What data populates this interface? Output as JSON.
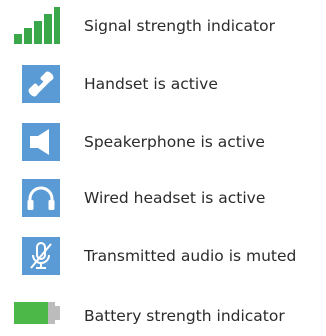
{
  "legend": {
    "items": [
      {
        "icon": "signal-strength-icon",
        "label": "Signal strength indicator"
      },
      {
        "icon": "handset-icon",
        "label": "Handset is active"
      },
      {
        "icon": "speakerphone-icon",
        "label": "Speakerphone is active"
      },
      {
        "icon": "wired-headset-icon",
        "label": "Wired headset is active"
      },
      {
        "icon": "muted-microphone-icon",
        "label": "Transmitted audio is muted"
      },
      {
        "icon": "battery-strength-icon",
        "label": "Battery strength indicator"
      }
    ]
  },
  "colors": {
    "tile_blue": "#5b9bd5",
    "signal_green": "#3aa84a",
    "battery_green": "#4cb848",
    "battery_gray": "#bcbcbc"
  }
}
